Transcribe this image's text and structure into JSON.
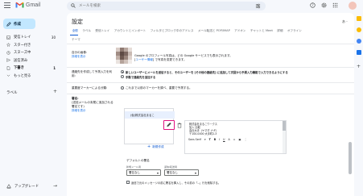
{
  "app": {
    "name": "Gmail"
  },
  "search": {
    "placeholder": "メールを検索"
  },
  "compose": {
    "label": "作成"
  },
  "nav": {
    "items": [
      {
        "label": "受信トレイ",
        "count": "30"
      },
      {
        "label": "スター付き",
        "count": ""
      },
      {
        "label": "スヌーズ中",
        "count": ""
      },
      {
        "label": "送信済み",
        "count": ""
      },
      {
        "label": "下書き",
        "count": "1"
      },
      {
        "label": "もっと見る",
        "count": ""
      }
    ],
    "labels_heading": "ラベル",
    "upgrade": "アップグレード"
  },
  "settings": {
    "title": "設定",
    "lang": "あ -",
    "tabs": [
      "全般",
      "ラベル",
      "受信トレイ",
      "アカウントとインポート",
      "フィルタとブロック中のアドレス",
      "メール転送と POP/IMAP",
      "アドオン",
      "チャットと Meet",
      "詳細",
      "オフライン"
    ],
    "theme_tab": "テーマ",
    "picture": {
      "label": "自分の画像:",
      "link": "詳細を表示",
      "desc1": "Google のプロフィール写真は、どの Google サービスでも表示されます。",
      "desc2_prefix": "[",
      "desc2_link": "ユーザー情報",
      "desc2_suffix": "] で写真を変更できます。"
    },
    "contacts": {
      "label_line1": "連絡先を作成して予測入力を利",
      "label_line2": "用:",
      "option1": "新しいユーザーにメールを送信すると、そのユーザーを [その他の連絡先] に追加して次回から予測入力機能で入力できるようにする",
      "option2": "手動で連絡先を追加する"
    },
    "importance": {
      "label": "重要度マーカーによる分類:",
      "text": "これまで以前のマーカーを調べ、重要で予測する。"
    },
    "signature": {
      "label": "署名:",
      "sublabel1": "(送信メールの末尾に追加される",
      "sublabel2": "署名です)",
      "link": "詳細を表示",
      "item_name": "(仮)株式会社まるこ",
      "editor_lines": [
        "株式会社まるこワークス",
        "加入 比較",
        "会社大手（ヤマダ ナギ）",
        "〒100-0000 大手町2-3"
      ],
      "font": "Sans Serif",
      "new_button": "新規作成"
    },
    "defaults": {
      "heading": "デフォルトの署名",
      "new_label": "新規メール用",
      "reply_label": "返信/転送用",
      "new_value": "署名なし",
      "reply_value": "署名なし",
      "checkbox_text": "返信で元のメッセージの前に署名を挿入し、その前の「--」行を削除する。"
    }
  },
  "colors": {
    "accent": "#0b57d0",
    "highlight_box": "#e0117f",
    "compose_bg": "#c2e7ff"
  }
}
